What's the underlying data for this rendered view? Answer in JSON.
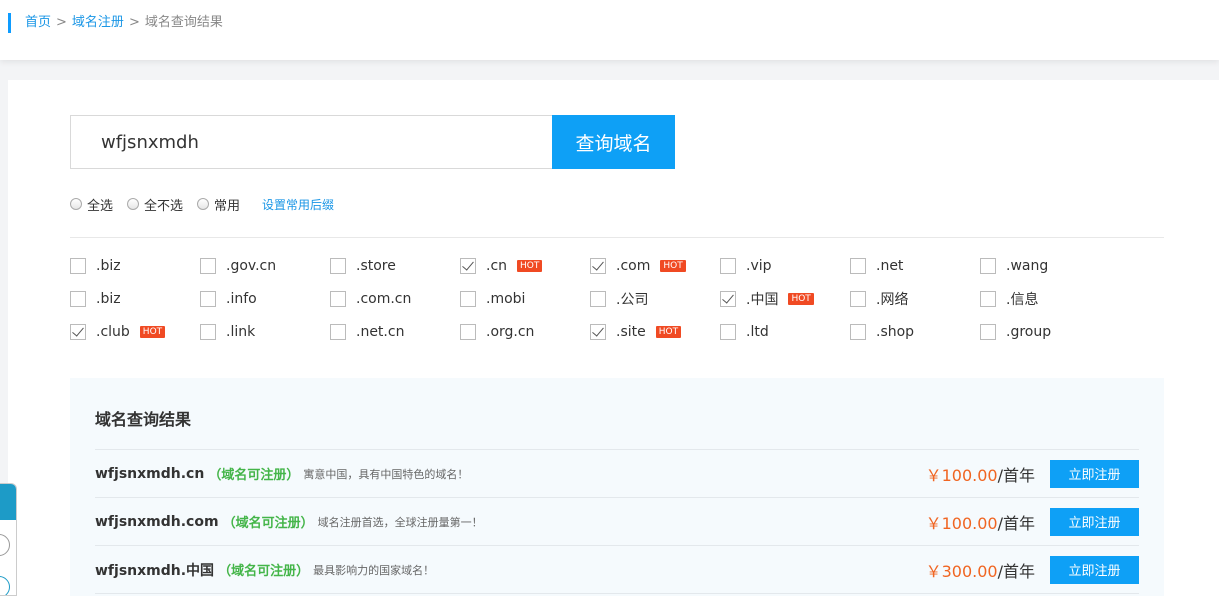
{
  "breadcrumb": {
    "home": "首页",
    "sep": ">",
    "register": "域名注册",
    "current": "域名查询结果"
  },
  "search": {
    "value": "wfjsnxmdh",
    "button": "查询域名"
  },
  "select_options": {
    "all": "全选",
    "none": "全不选",
    "common": "常用",
    "set_common": "设置常用后缀"
  },
  "suffixes": [
    [
      {
        "label": ".biz",
        "checked": false,
        "hot": false
      },
      {
        "label": ".gov.cn",
        "checked": false,
        "hot": false
      },
      {
        "label": ".store",
        "checked": false,
        "hot": false
      },
      {
        "label": ".cn",
        "checked": true,
        "hot": true
      },
      {
        "label": ".com",
        "checked": true,
        "hot": true
      },
      {
        "label": ".vip",
        "checked": false,
        "hot": false
      },
      {
        "label": ".net",
        "checked": false,
        "hot": false
      },
      {
        "label": ".wang",
        "checked": false,
        "hot": false
      }
    ],
    [
      {
        "label": ".biz",
        "checked": false,
        "hot": false
      },
      {
        "label": ".info",
        "checked": false,
        "hot": false
      },
      {
        "label": ".com.cn",
        "checked": false,
        "hot": false
      },
      {
        "label": ".mobi",
        "checked": false,
        "hot": false
      },
      {
        "label": ".公司",
        "checked": false,
        "hot": false
      },
      {
        "label": ".中国",
        "checked": true,
        "hot": true
      },
      {
        "label": ".网络",
        "checked": false,
        "hot": false
      },
      {
        "label": ".信息",
        "checked": false,
        "hot": false
      }
    ],
    [
      {
        "label": ".club",
        "checked": true,
        "hot": true
      },
      {
        "label": ".link",
        "checked": false,
        "hot": false
      },
      {
        "label": ".net.cn",
        "checked": false,
        "hot": false
      },
      {
        "label": ".org.cn",
        "checked": false,
        "hot": false
      },
      {
        "label": ".site",
        "checked": true,
        "hot": true
      },
      {
        "label": ".ltd",
        "checked": false,
        "hot": false
      },
      {
        "label": ".shop",
        "checked": false,
        "hot": false
      },
      {
        "label": ".group",
        "checked": false,
        "hot": false
      }
    ]
  ],
  "hot_badge": "HOT",
  "results": {
    "title": "域名查询结果",
    "rows": [
      {
        "domain": "wfjsnxmdh.cn",
        "status": "（域名可注册）",
        "desc": "寓意中国，具有中国特色的域名！",
        "price": "￥100.00",
        "unit": "/首年",
        "button": "立即注册"
      },
      {
        "domain": "wfjsnxmdh.com",
        "status": "（域名可注册）",
        "desc": "域名注册首选，全球注册量第一！",
        "price": "￥100.00",
        "unit": "/首年",
        "button": "立即注册"
      },
      {
        "domain": "wfjsnxmdh.中国",
        "status": "（域名可注册）",
        "desc": "最具影响力的国家域名！",
        "price": "￥300.00",
        "unit": "/首年",
        "button": "立即注册"
      }
    ]
  },
  "colors": {
    "accent": "#0ea0f6",
    "link": "#1a96e6",
    "hot": "#f04a23",
    "available": "#44b549",
    "price": "#f06522"
  }
}
